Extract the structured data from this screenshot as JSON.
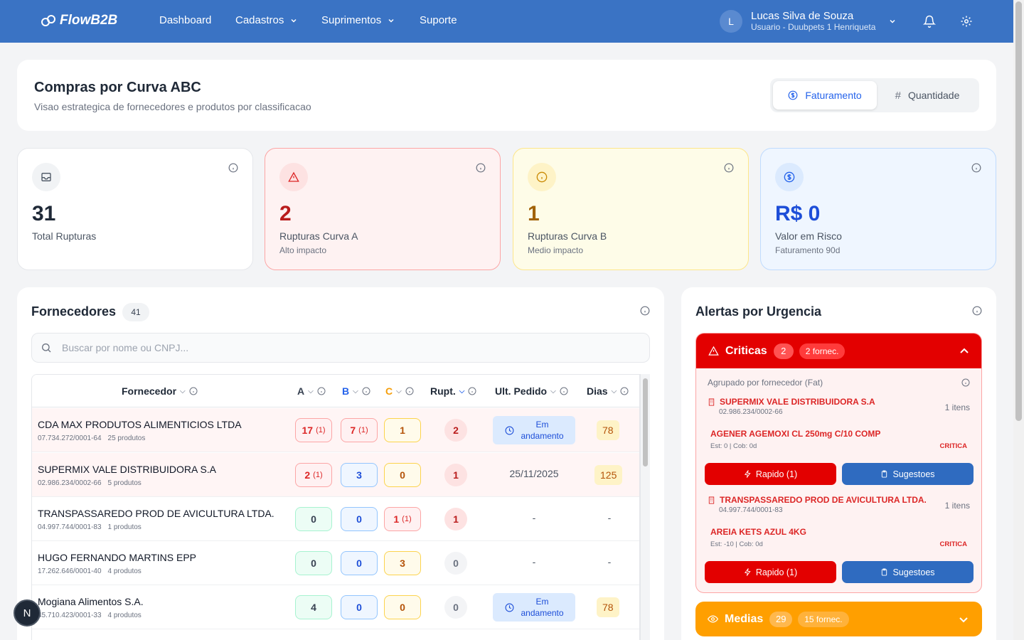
{
  "nav": {
    "brand": "FlowB2B",
    "items": [
      "Dashboard",
      "Cadastros",
      "Suprimentos",
      "Suporte"
    ],
    "user": {
      "initial": "L",
      "name": "Lucas Silva de Souza",
      "role": "Usuario - Duubpets 1 Henriqueta"
    }
  },
  "header": {
    "title": "Compras por Curva ABC",
    "subtitle": "Visao estrategica de fornecedores e produtos por classificacao",
    "toggle": [
      "Faturamento",
      "Quantidade"
    ],
    "toggle_selected": "Faturamento"
  },
  "stats": [
    {
      "value": "31",
      "label": "Total Rupturas",
      "sub": "",
      "color": "#1f2937",
      "bg": "#ffffff",
      "icon": "inbox-icon"
    },
    {
      "value": "2",
      "label": "Rupturas Curva A",
      "sub": "Alto impacto",
      "color": "#b91c1c",
      "bg": "#fef2f2",
      "icon": "warning-icon"
    },
    {
      "value": "1",
      "label": "Rupturas Curva B",
      "sub": "Medio impacto",
      "color": "#a16207",
      "bg": "#fefce8",
      "icon": "info-icon"
    },
    {
      "value": "R$ 0",
      "label": "Valor em Risco",
      "sub": "Faturamento 90d",
      "color": "#1d4ed8",
      "bg": "#eff6ff",
      "icon": "dollar-icon"
    }
  ],
  "fornecedores": {
    "title": "Fornecedores",
    "count": "41",
    "search_placeholder": "Buscar por nome ou CNPJ...",
    "columns": [
      "Fornecedor",
      "A",
      "B",
      "C",
      "Rupt.",
      "Ult. Pedido",
      "Dias"
    ],
    "rows": [
      {
        "name": "CDA MAX PRODUTOS ALIMENTICIOS LTDA",
        "cnpj": "07.734.272/0001-64",
        "produtos": "25 produtos",
        "a": "17",
        "a_sub": "(1)",
        "b": "7",
        "b_sub": "(1)",
        "c": "1",
        "c_sub": "",
        "rupt": "2",
        "pedido": "Em andamento",
        "dias": "78"
      },
      {
        "name": "SUPERMIX VALE DISTRIBUIDORA S.A",
        "cnpj": "02.986.234/0002-66",
        "produtos": "5 produtos",
        "a": "2",
        "a_sub": "(1)",
        "b": "3",
        "b_sub": "",
        "c": "0",
        "c_sub": "",
        "rupt": "1",
        "pedido": "25/11/2025",
        "dias": "125"
      },
      {
        "name": "TRANSPASSAREDO PROD DE AVICULTURA LTDA.",
        "cnpj": "04.997.744/0001-83",
        "produtos": "1 produtos",
        "a": "0",
        "a_sub": "",
        "b": "0",
        "b_sub": "",
        "c": "1",
        "c_sub": "(1)",
        "rupt": "1",
        "pedido": "-",
        "dias": "-"
      },
      {
        "name": "HUGO FERNANDO MARTINS EPP",
        "cnpj": "17.262.646/0001-40",
        "produtos": "4 produtos",
        "a": "0",
        "a_sub": "",
        "b": "0",
        "b_sub": "",
        "c": "3",
        "c_sub": "",
        "rupt": "0",
        "pedido": "-",
        "dias": "-"
      },
      {
        "name": "Mogiana Alimentos S.A.",
        "cnpj": "45.710.423/0001-33",
        "produtos": "4 produtos",
        "a": "4",
        "a_sub": "",
        "b": "0",
        "b_sub": "",
        "c": "0",
        "c_sub": "",
        "rupt": "0",
        "pedido": "Em andamento",
        "dias": "78"
      }
    ]
  },
  "alertas": {
    "title": "Alertas por Urgencia",
    "criticas": {
      "label": "Criticas",
      "count": "2",
      "fornec": "2 fornec.",
      "group_label": "Agrupado por fornecedor (Fat)",
      "suppliers": [
        {
          "name": "SUPERMIX VALE DISTRIBUIDORA S.A",
          "cnpj": "02.986.234/0002-66",
          "itens": "1 itens",
          "product": "AGENER AGEMOXI CL 250mg C/10 COMP",
          "stock": "Est: 0 | Cob: 0d",
          "tag": "CRITICA",
          "rapido": "Rapido (1)",
          "sugestoes": "Sugestoes"
        },
        {
          "name": "TRANSPASSAREDO PROD DE AVICULTURA LTDA.",
          "cnpj": "04.997.744/0001-83",
          "itens": "1 itens",
          "product": "AREIA KETS AZUL 4KG",
          "stock": "Est: -10 | Cob: 0d",
          "tag": "CRITICA",
          "rapido": "Rapido (1)",
          "sugestoes": "Sugestoes"
        }
      ]
    },
    "medias": {
      "label": "Medias",
      "count": "29",
      "fornec": "15 fornec."
    }
  },
  "fab_label": "N"
}
